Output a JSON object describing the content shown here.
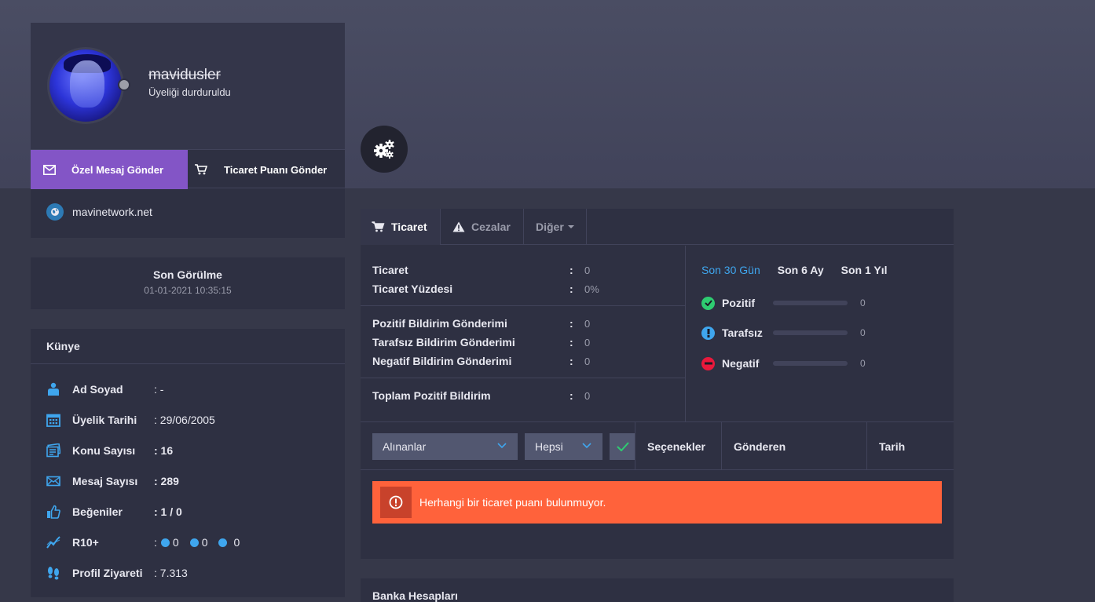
{
  "profile": {
    "username": "mavidusler",
    "status": "Üyeliği durduruldu",
    "send_message_label": "Özel Mesaj Gönder",
    "send_trade_label": "Ticaret Puanı Gönder",
    "website": "mavinetwork.net"
  },
  "last_seen": {
    "title": "Son Görülme",
    "date": "01-01-2021 10:35:15"
  },
  "kunye": {
    "title": "Künye",
    "rows": [
      {
        "label": "Ad Soyad",
        "value": ": -"
      },
      {
        "label": "Üyelik Tarihi",
        "value": ": 29/06/2005"
      },
      {
        "label": "Konu Sayısı",
        "value": ": 16"
      },
      {
        "label": "Mesaj Sayısı",
        "value": ": 289"
      },
      {
        "label": "Beğeniler",
        "value": ": 1 / 0"
      },
      {
        "label": "R10+",
        "value": ":",
        "r10": [
          "0",
          "0",
          "0"
        ]
      },
      {
        "label": "Profil Ziyareti",
        "value": ": 7.313"
      }
    ]
  },
  "tabs": {
    "ticaret": "Ticaret",
    "cezalar": "Cezalar",
    "diger": "Diğer"
  },
  "stats": {
    "ticaret": {
      "label": "Ticaret",
      "value": "0"
    },
    "ticaret_yuzdesi": {
      "label": "Ticaret Yüzdesi",
      "value": "0%"
    },
    "pozitif_gonderim": {
      "label": "Pozitif Bildirim Gönderimi",
      "value": "0"
    },
    "tarafsiz_gonderim": {
      "label": "Tarafsız Bildirim Gönderimi",
      "value": "0"
    },
    "negatif_gonderim": {
      "label": "Negatif Bildirim Gönderimi",
      "value": "0"
    },
    "toplam_pozitif": {
      "label": "Toplam Pozitif Bildirim",
      "value": "0"
    },
    "colon": ":"
  },
  "periods": [
    "Son 30 Gün",
    "Son 6 Ay",
    "Son 1 Yıl"
  ],
  "feedback": {
    "pozitif": {
      "label": "Pozitif",
      "value": "0",
      "fraction": 0
    },
    "tarafsiz": {
      "label": "Tarafsız",
      "value": "0",
      "fraction": 0
    },
    "negatif": {
      "label": "Negatif",
      "value": "0",
      "fraction": 0
    }
  },
  "filters": {
    "direction": "Alınanlar",
    "type": "Hepsi"
  },
  "columns": [
    "Seçenekler",
    "Gönderen",
    "Tarih"
  ],
  "alert": "Herhangi bir ticaret puanı bulunmuyor.",
  "bank_title": "Banka Hesapları",
  "colors": {
    "accent": "#8355c6",
    "link": "#3fa6ee",
    "alert": "#ff623b",
    "positive": "#2ecc71",
    "negative": "#e8193c"
  }
}
